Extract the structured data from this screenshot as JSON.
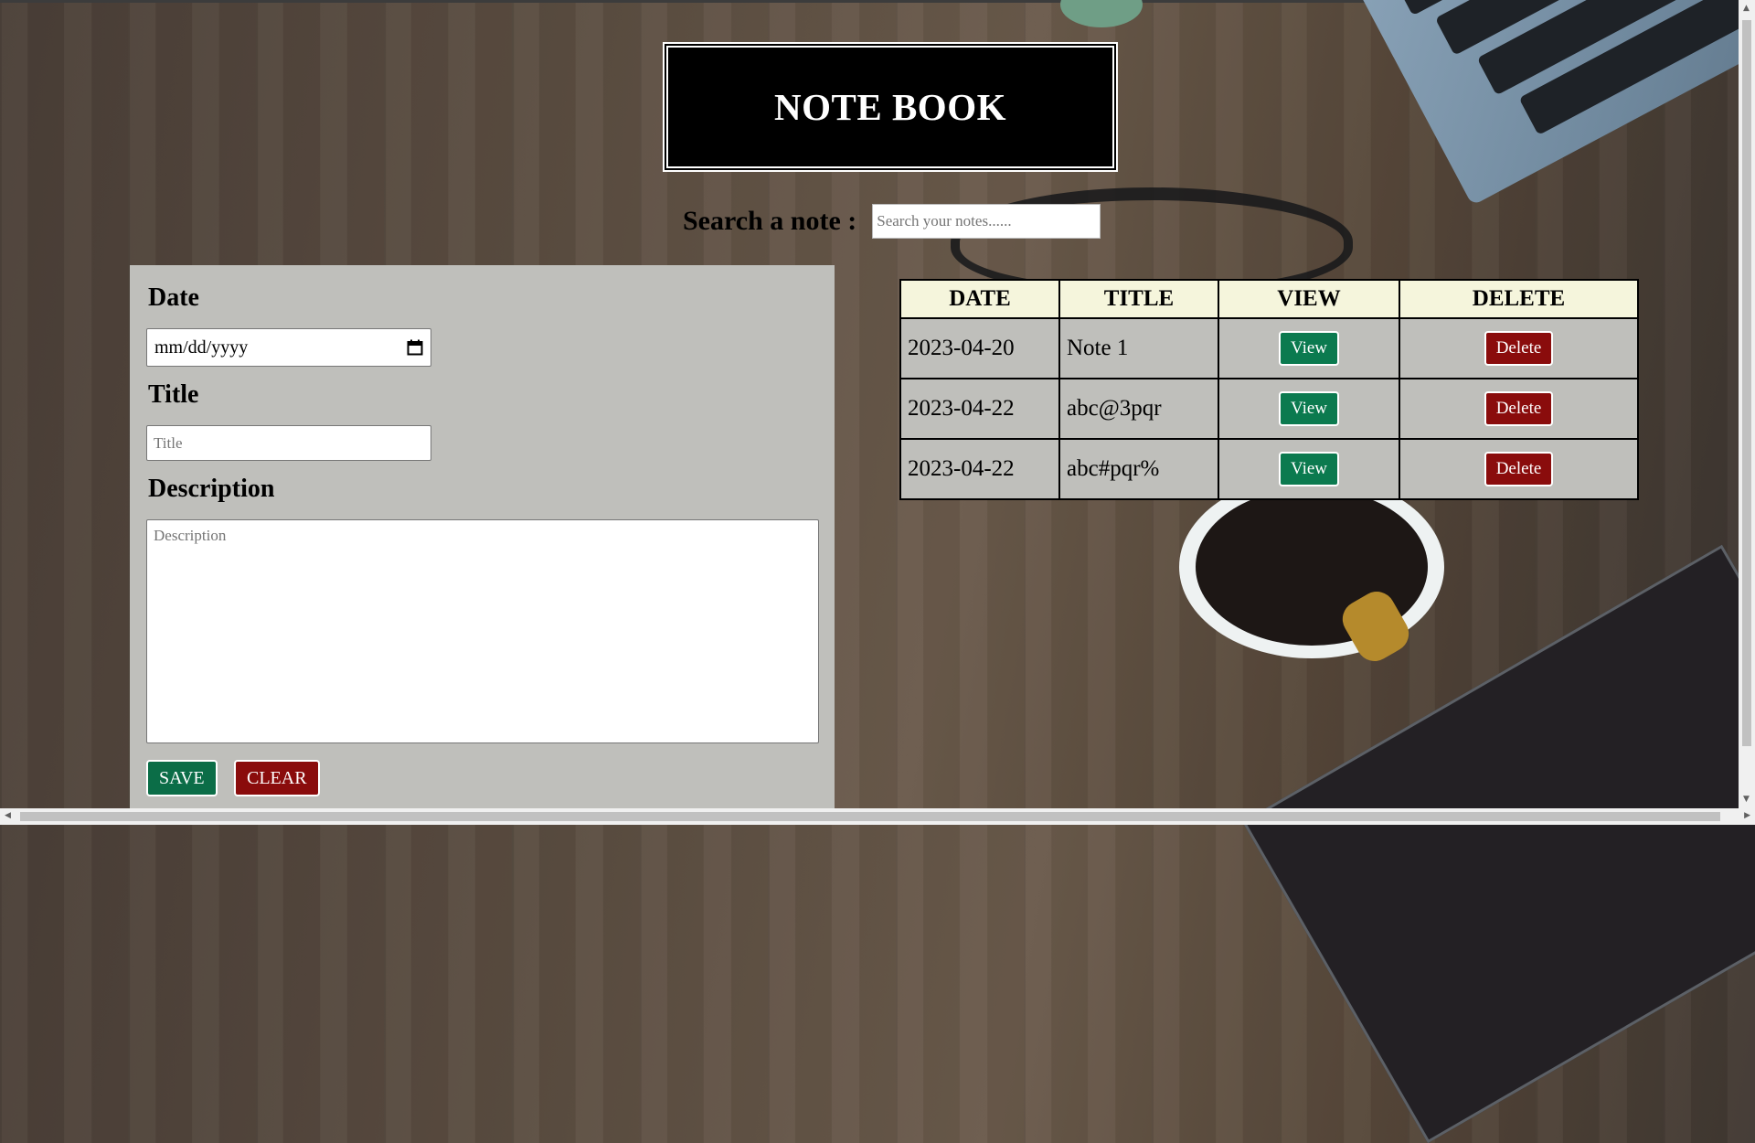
{
  "header": {
    "title": "NOTE BOOK"
  },
  "search": {
    "label": "Search a note :",
    "placeholder": "Search your notes......"
  },
  "form": {
    "date_label": "Date",
    "date_placeholder": "mm/dd/yyyy",
    "title_label": "Title",
    "title_placeholder": "Title",
    "description_label": "Description",
    "description_placeholder": "Description",
    "save_label": "SAVE",
    "clear_label": "CLEAR"
  },
  "table": {
    "headers": [
      "DATE",
      "TITLE",
      "VIEW",
      "DELETE"
    ],
    "rows": [
      {
        "date": "2023-04-20",
        "title": "Note 1",
        "view_label": "View",
        "delete_label": "Delete"
      },
      {
        "date": "2023-04-22",
        "title": "abc@3pqr",
        "view_label": "View",
        "delete_label": "Delete"
      },
      {
        "date": "2023-04-22",
        "title": "abc#pqr%",
        "view_label": "View",
        "delete_label": "Delete"
      }
    ]
  },
  "colors": {
    "save_button": "#0b6d47",
    "clear_button": "#8a0c0c",
    "view_button": "#0b7a4f",
    "delete_button": "#8a0c0c",
    "table_header": "#f5f5dc",
    "panel": "#bfbfbb"
  },
  "icons": {
    "date_picker": "calendar-icon"
  }
}
